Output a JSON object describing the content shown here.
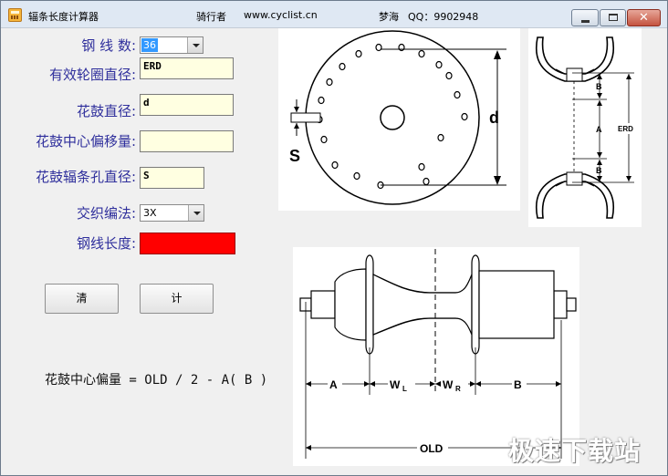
{
  "window": {
    "title": "辐条长度计算器",
    "author_label": "骑行者",
    "website": "www.cyclist.cn",
    "contact": "梦海",
    "qq": "QQ：9902948"
  },
  "form": {
    "spoke_count": {
      "label": "钢 线 数:",
      "value": "36"
    },
    "erd": {
      "label": "有效轮圈直径:",
      "value": "ERD"
    },
    "flange_dia": {
      "label": "花鼓直径:",
      "value": "d"
    },
    "center_offset": {
      "label": "花鼓中心偏移量:",
      "value": ""
    },
    "hole_dia": {
      "label": "花鼓辐条孔直径:",
      "value": "S"
    },
    "lacing": {
      "label": "交织编法:",
      "value": "3X"
    },
    "spoke_length": {
      "label": "钢线长度:"
    }
  },
  "buttons": {
    "clear": "清",
    "calc": "计"
  },
  "formula": "花鼓中心偏量 = OLD / 2 - A( B )",
  "diagram": {
    "hub_label_d": "d",
    "hub_label_s": "S",
    "rim_labels": {
      "b1": "B",
      "a": "A",
      "b2": "B",
      "erd": "ERD"
    },
    "side_labels": {
      "a": "A",
      "wl": "W",
      "wl_sub": "L",
      "wr": "W",
      "wr_sub": "R",
      "b": "B",
      "old": "OLD"
    }
  },
  "watermark": "极速下载站",
  "colors": {
    "label_text": "#2f2f9c",
    "field_bg": "#ffffe1",
    "result": "#ff0000",
    "title_bar": "#dfe8f3"
  }
}
